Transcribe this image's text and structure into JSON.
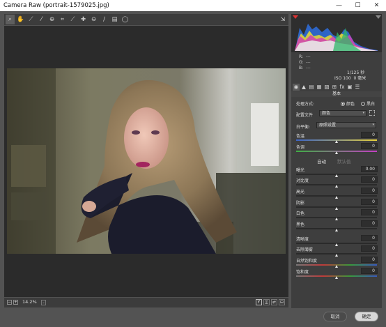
{
  "window": {
    "title": "Camera Raw (portrait-1579025.jpg)",
    "minimize": "—",
    "maximize": "☐",
    "close": "✕"
  },
  "toolbar": {
    "tools": [
      {
        "name": "zoom-tool",
        "icon": "⌕"
      },
      {
        "name": "hand-tool",
        "icon": "✋"
      },
      {
        "name": "white-balance-tool",
        "icon": "⟋"
      },
      {
        "name": "color-sampler-tool",
        "icon": "⁄"
      },
      {
        "name": "targeted-adjustment-tool",
        "icon": "⊕"
      },
      {
        "name": "crop-tool",
        "icon": "⌗"
      },
      {
        "name": "straighten-tool",
        "icon": "⟋"
      },
      {
        "name": "spot-removal-tool",
        "icon": "✚"
      },
      {
        "name": "red-eye-tool",
        "icon": "⊖"
      },
      {
        "name": "adjustment-brush-tool",
        "icon": "∕"
      },
      {
        "name": "graduated-filter-tool",
        "icon": "▤"
      },
      {
        "name": "radial-filter-tool",
        "icon": "◯"
      }
    ],
    "fullscreen_icon": "⇲"
  },
  "statusbar": {
    "zoom_out": "−",
    "zoom_in": "+",
    "zoom_value": "14.2%",
    "zoom_dropdown": "⌄",
    "view_y": "Y",
    "view_before_after": "◫",
    "view_swap": "⇄",
    "view_copy": "⊟"
  },
  "histogram": {
    "r_label": "R:",
    "g_label": "G:",
    "b_label": "B:",
    "r_value": "---",
    "g_value": "---",
    "b_value": "---",
    "shutter": "1/125 秒",
    "iso": "ISO 100",
    "focal": "0 毫米"
  },
  "panel_tabs": [
    "◉",
    "▲",
    "▤",
    "▦",
    "▧",
    "⊞",
    "fx",
    "▣",
    "☰"
  ],
  "basic": {
    "title": "基本",
    "treatment_label": "处理方式:",
    "treatment_color": "颜色",
    "treatment_bw": "黑白",
    "profile_label": "配置文件",
    "profile_value": "颜色",
    "wb_label": "白平衡:",
    "wb_value": "原照设置",
    "auto": "自动",
    "default": "默认值"
  },
  "sliders": [
    {
      "name": "temperature",
      "label": "色温",
      "value": "0",
      "pos": 0.5
    },
    {
      "name": "tint",
      "label": "色调",
      "value": "0",
      "pos": 0.5
    },
    {
      "name": "exposure",
      "label": "曝光",
      "value": "0.00",
      "pos": 0.5
    },
    {
      "name": "contrast",
      "label": "对比度",
      "value": "0",
      "pos": 0.5
    },
    {
      "name": "highlights",
      "label": "高光",
      "value": "0",
      "pos": 0.5
    },
    {
      "name": "shadows",
      "label": "阴影",
      "value": "0",
      "pos": 0.5
    },
    {
      "name": "whites",
      "label": "白色",
      "value": "0",
      "pos": 0.5
    },
    {
      "name": "blacks",
      "label": "黑色",
      "value": "0",
      "pos": 0.5
    },
    {
      "name": "clarity",
      "label": "清晰度",
      "value": "0",
      "pos": 0.5
    },
    {
      "name": "dehaze",
      "label": "去除薄雾",
      "value": "0",
      "pos": 0.5
    },
    {
      "name": "vibrance",
      "label": "自然饱和度",
      "value": "0",
      "pos": 0.5
    },
    {
      "name": "saturation",
      "label": "饱和度",
      "value": "0",
      "pos": 0.5
    }
  ],
  "buttons": {
    "cancel": "取消",
    "ok": "确定"
  },
  "colors": {
    "panel_bg": "#3e3e3e",
    "canvas_bg": "#2b2b2b",
    "frame_bg": "#535353"
  }
}
